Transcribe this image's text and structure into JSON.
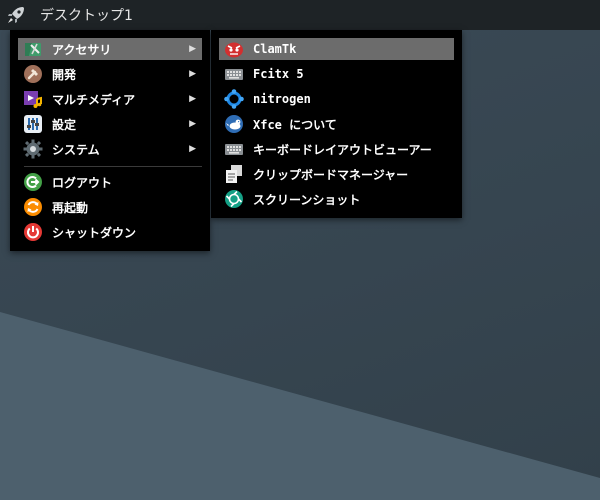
{
  "panel": {
    "workspace_label": "デスクトップ1",
    "launcher_icon": "rocket-icon"
  },
  "main_menu": {
    "items": [
      {
        "label": "アクセサリ",
        "icon": "accessories-icon",
        "has_submenu": true,
        "active": true
      },
      {
        "label": "開発",
        "icon": "development-icon",
        "has_submenu": true
      },
      {
        "label": "マルチメディア",
        "icon": "multimedia-icon",
        "has_submenu": true
      },
      {
        "label": "設定",
        "icon": "settings-icon",
        "has_submenu": true
      },
      {
        "label": "システム",
        "icon": "system-icon",
        "has_submenu": true
      },
      {
        "label": "ログアウト",
        "icon": "logout-icon"
      },
      {
        "label": "再起動",
        "icon": "restart-icon"
      },
      {
        "label": "シャットダウン",
        "icon": "shutdown-icon"
      }
    ],
    "arrow_glyph": "▶"
  },
  "sub_menu": {
    "items": [
      {
        "label": "ClamTk",
        "icon": "clamtk-icon",
        "active": true
      },
      {
        "label": "Fcitx 5",
        "icon": "keyboard-icon"
      },
      {
        "label": "nitrogen",
        "icon": "nitrogen-icon"
      },
      {
        "label": "Xfce について",
        "icon": "xfce-icon"
      },
      {
        "label": "キーボードレイアウトビューアー",
        "icon": "keyboard-layout-icon"
      },
      {
        "label": "クリップボードマネージャー",
        "icon": "clipboard-icon"
      },
      {
        "label": "スクリーンショット",
        "icon": "screenshot-icon"
      }
    ]
  },
  "colors": {
    "panel_bg": "#1e2326",
    "menu_bg": "#000000",
    "highlight": "#6c6c6c",
    "desktop": "#364550"
  }
}
